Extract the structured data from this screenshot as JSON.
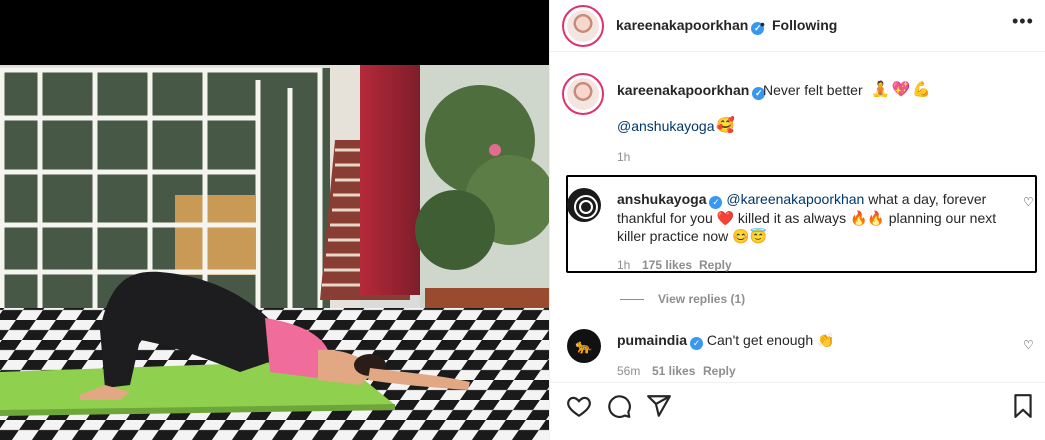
{
  "header": {
    "username": "kareenakapoorkhan",
    "verified_mark": "✓",
    "separator": "•",
    "follow_status": "Following",
    "more_label": "•••"
  },
  "caption": {
    "username": "kareenakapoorkhan",
    "text": "Never felt better",
    "emojis": "🧘💖💪",
    "mention": "@anshukayoga",
    "mention_emoji": "🥰",
    "time": "1h"
  },
  "comments": [
    {
      "username": "anshukayoga",
      "mention": "@kareenakapoorkhan",
      "text": "what a day, forever thankful for you ❤️ killed it as always 🔥🔥 planning our next killer practice now 😊😇",
      "time": "1h",
      "likes": "175 likes",
      "reply": "Reply"
    },
    {
      "username": "pumaindia",
      "text": "Can't get enough 👏",
      "time": "56m",
      "likes": "51 likes",
      "reply": "Reply",
      "avatar_glyph": "🐆"
    }
  ],
  "view_replies": "View replies (1)",
  "colors": {
    "link": "#00376b",
    "meta": "#8e8e8e",
    "verified": "#3897f0",
    "story_ring": "#e1306c",
    "mat": "#8fd14f"
  },
  "icons": [
    "more-icon",
    "heart-icon",
    "comment-icon",
    "share-icon",
    "bookmark-icon",
    "verified-icon"
  ]
}
